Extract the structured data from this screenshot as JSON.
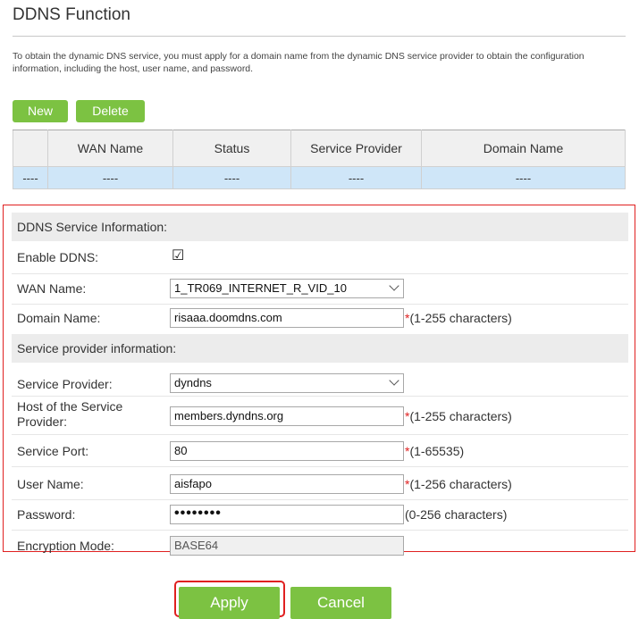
{
  "page": {
    "title": "DDNS Function",
    "description": "To obtain the dynamic DNS service, you must apply for a domain name from the dynamic DNS service provider to obtain the configuration information, including the host, user name, and password."
  },
  "toolbar": {
    "new_label": "New",
    "delete_label": "Delete"
  },
  "table": {
    "headers": [
      "",
      "WAN Name",
      "Status",
      "Service Provider",
      "Domain Name"
    ],
    "rows": [
      [
        "----",
        "----",
        "----",
        "----",
        "----"
      ]
    ]
  },
  "service_info": {
    "section_title": "DDNS Service Information:",
    "enable_label": "Enable DDNS:",
    "enable_checked": "☑",
    "wan_label": "WAN Name:",
    "wan_value": "1_TR069_INTERNET_R_VID_10",
    "domain_label": "Domain Name:",
    "domain_value": "risaaa.doomdns.com",
    "domain_hint": "(1-255 characters)"
  },
  "provider_info": {
    "section_title": "Service provider information:",
    "provider_label": "Service Provider:",
    "provider_value": "dyndns",
    "host_label": "Host of the Service Provider:",
    "host_value": "members.dyndns.org",
    "host_hint": "(1-255 characters)",
    "port_label": "Service Port:",
    "port_value": "80",
    "port_hint": "(1-65535)",
    "user_label": "User Name:",
    "user_value": "aisfapo",
    "user_hint": "(1-256 characters)",
    "password_label": "Password:",
    "password_value": "••••••••",
    "password_hint": "(0-256 characters)",
    "encryption_label": "Encryption Mode:",
    "encryption_value": "BASE64"
  },
  "actions": {
    "apply_label": "Apply",
    "cancel_label": "Cancel"
  },
  "colors": {
    "accent": "#7cc242",
    "highlight": "#e02020",
    "row_selected": "#cfe6f8"
  }
}
